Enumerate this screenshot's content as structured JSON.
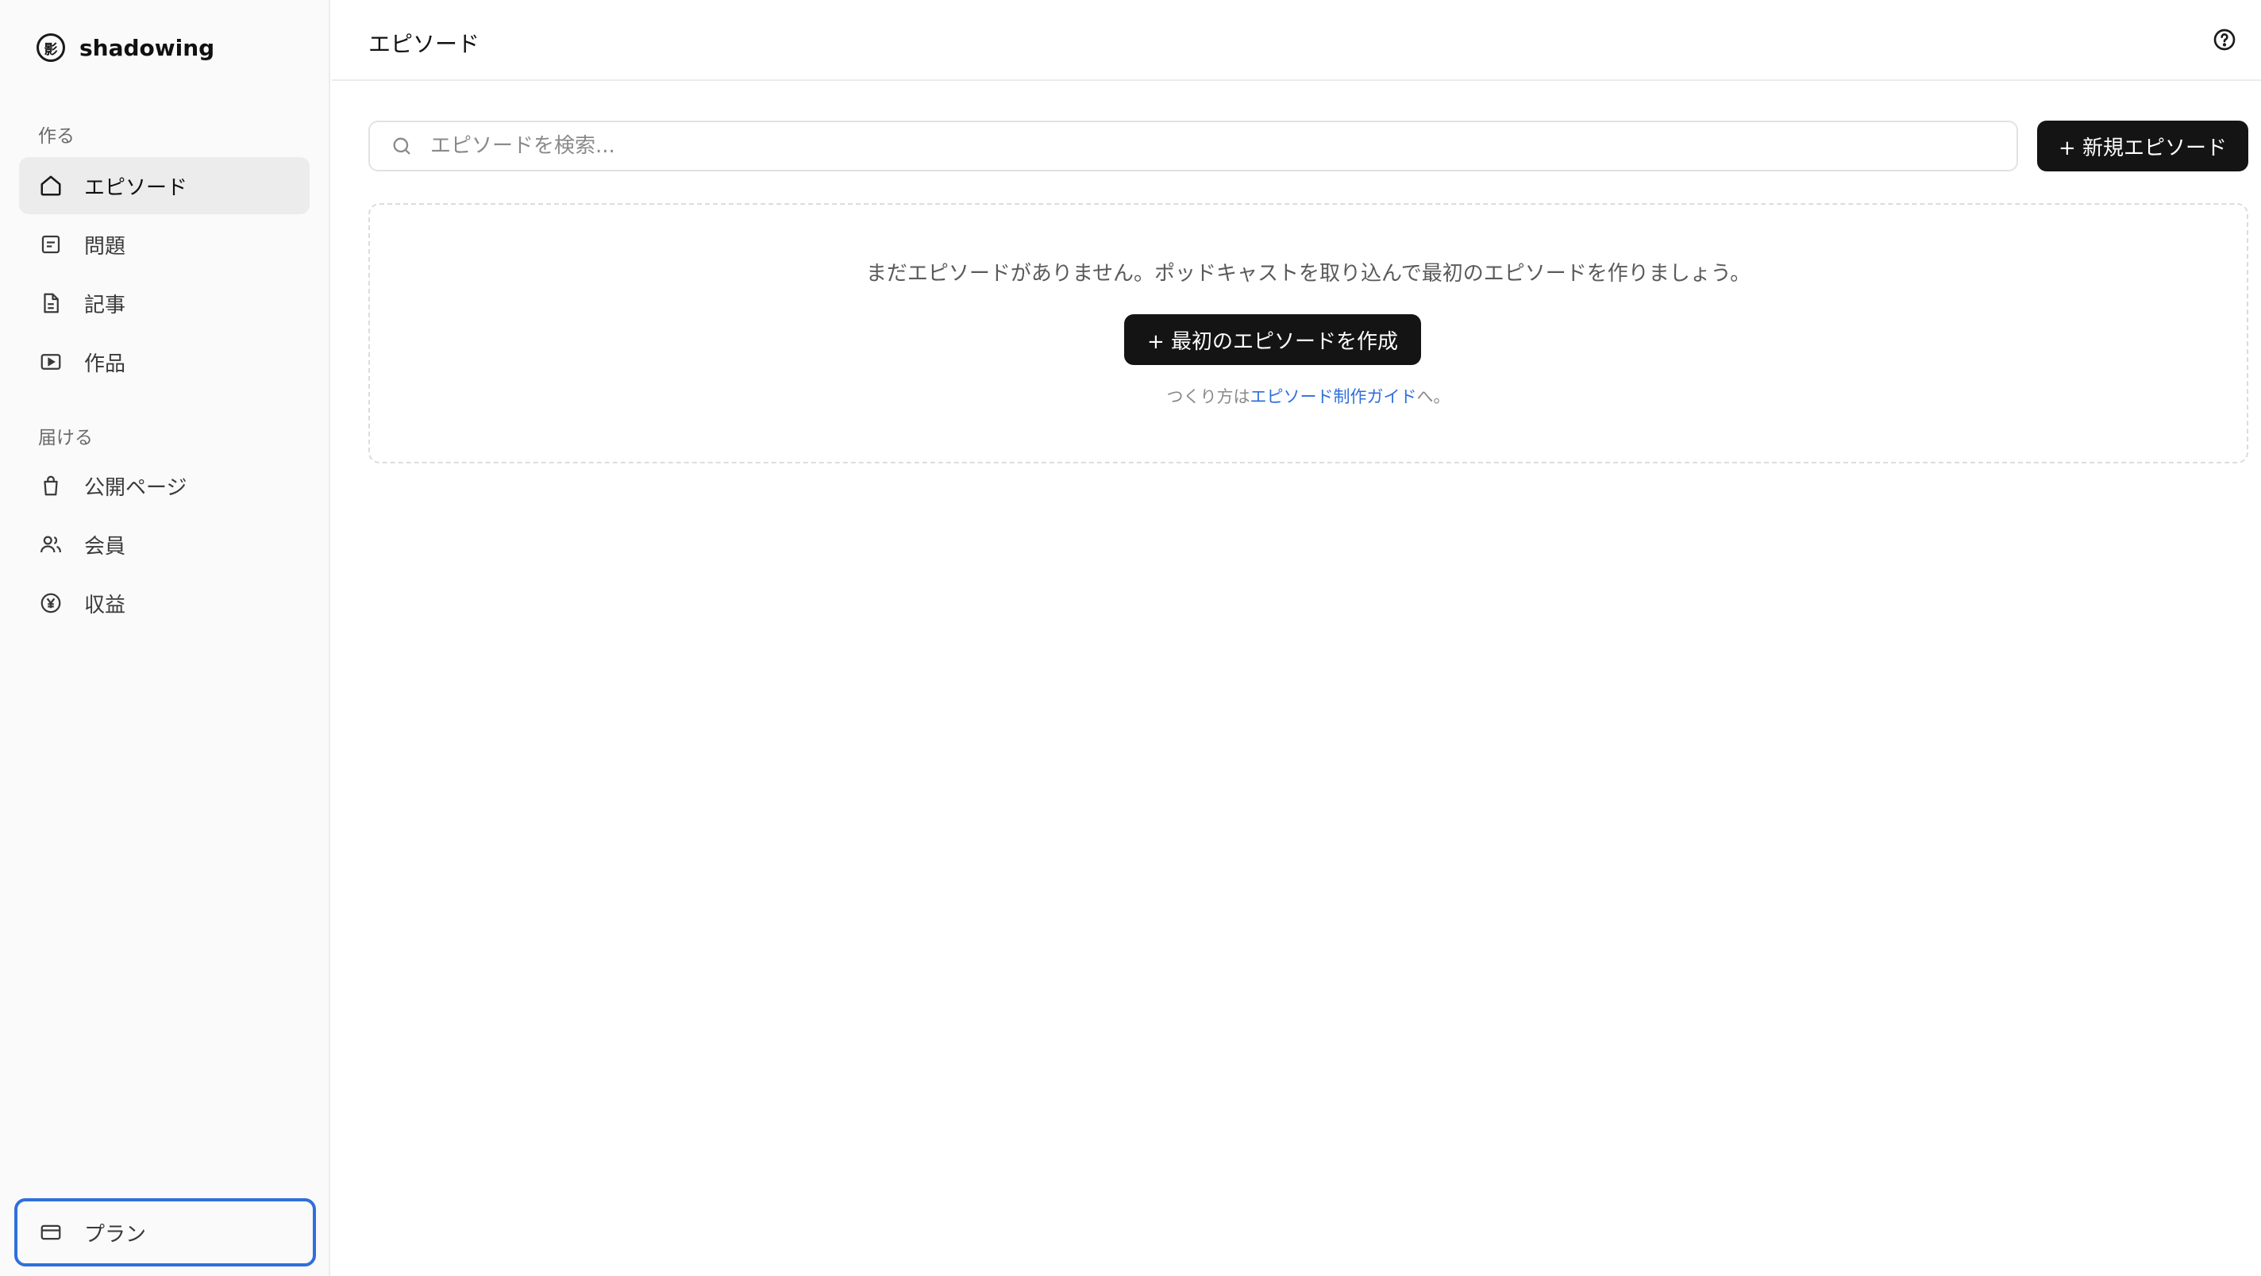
{
  "brand": {
    "logo_char": "影",
    "name": "shadowing"
  },
  "sidebar": {
    "section_create": "作る",
    "section_deliver": "届ける",
    "items": [
      {
        "label": "エピソード",
        "icon": "home-icon"
      },
      {
        "label": "問題",
        "icon": "list-icon"
      },
      {
        "label": "記事",
        "icon": "document-icon"
      },
      {
        "label": "作品",
        "icon": "play-icon"
      },
      {
        "label": "公開ページ",
        "icon": "bag-icon"
      },
      {
        "label": "会員",
        "icon": "users-icon"
      },
      {
        "label": "収益",
        "icon": "yen-icon"
      }
    ],
    "plan_label": "プラン"
  },
  "header": {
    "title": "エピソード"
  },
  "search": {
    "placeholder": "エピソードを検索..."
  },
  "toolbar": {
    "new_label": "+ 新規エピソード"
  },
  "empty_state": {
    "message": "まだエピソードがありません。ポッドキャストを取り込んで最初のエピソードを作りましょう。",
    "create_label": "+ 最初のエピソードを作成",
    "guide_prefix": "つくり方は",
    "guide_link": "エピソード制作ガイド",
    "guide_suffix": "へ。"
  },
  "colors": {
    "accent": "#2f6fdb",
    "primary_button": "#141414",
    "sidebar_bg": "#fafafa"
  }
}
